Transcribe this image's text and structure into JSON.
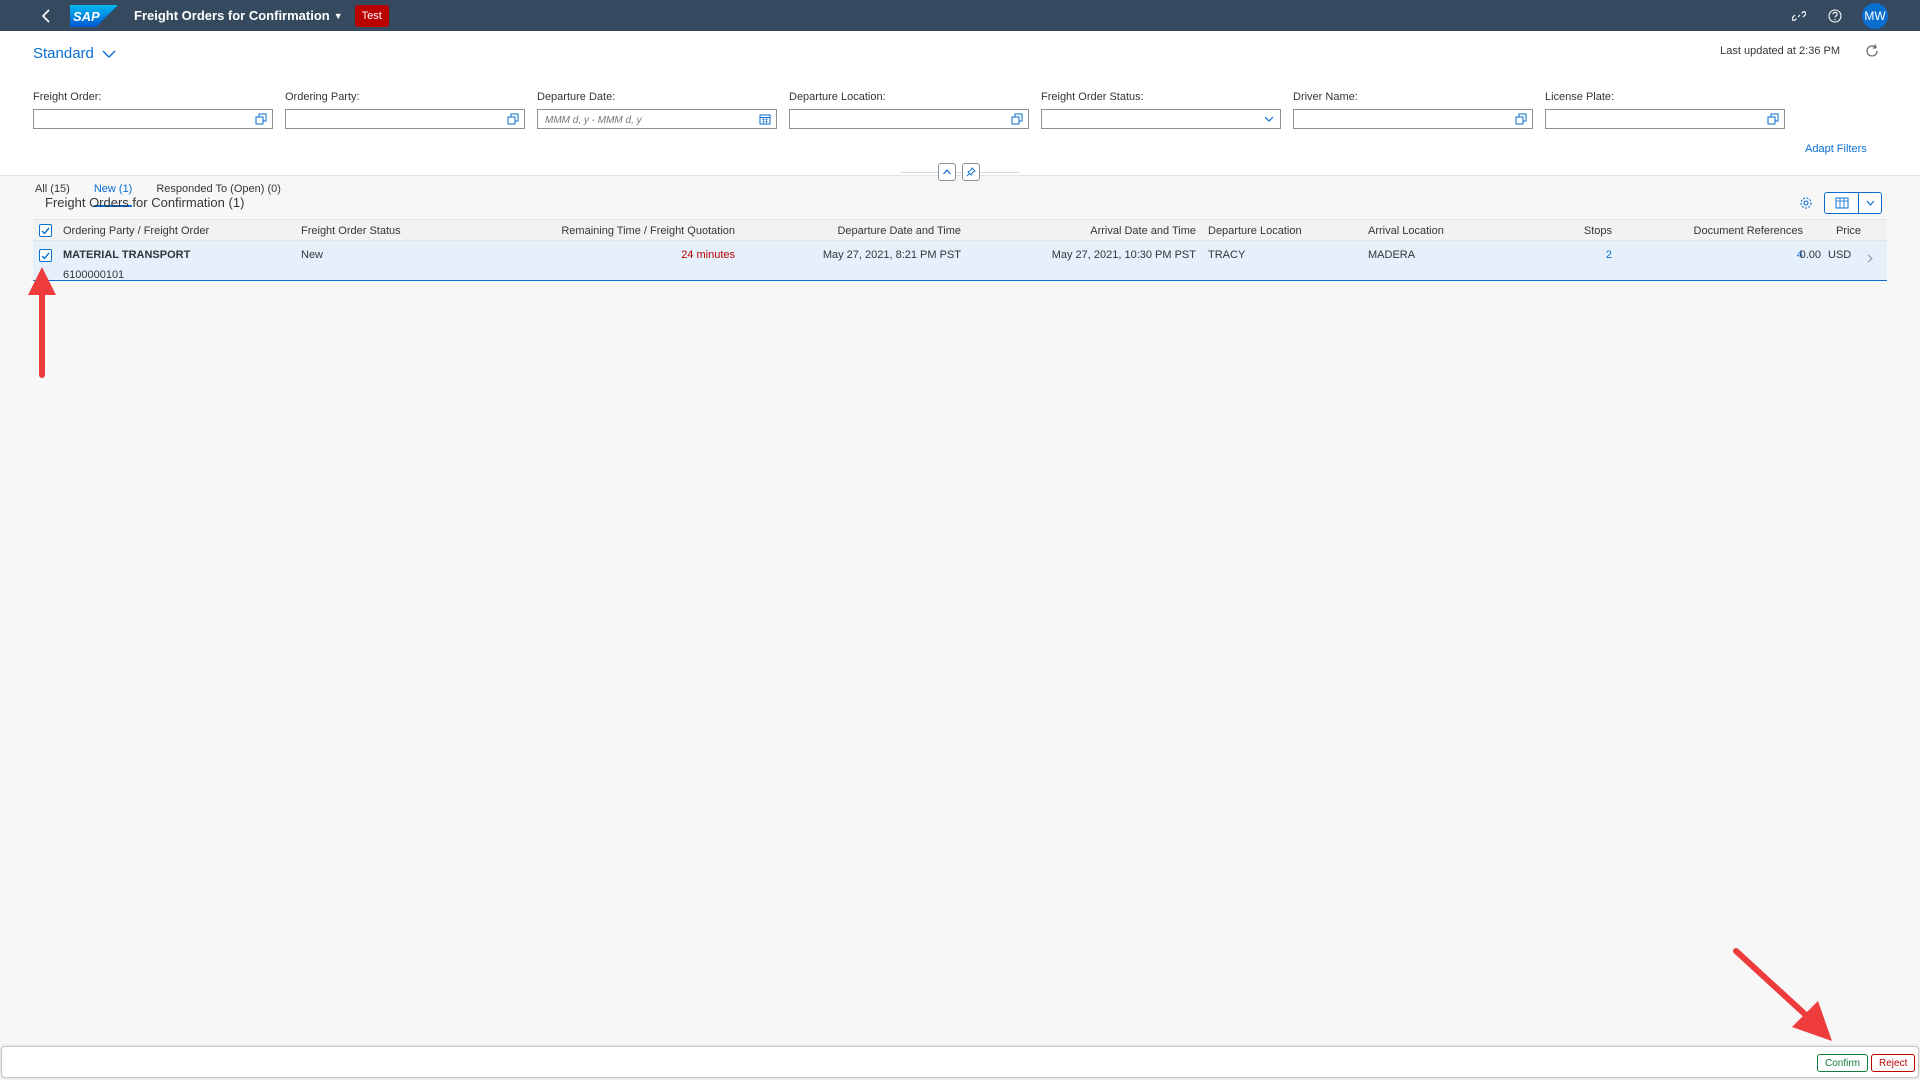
{
  "shell": {
    "logo": "SAP",
    "app_title": "Freight Orders for Confirmation",
    "badge": "Test",
    "avatar_initials": "MW",
    "icons": [
      "back-icon",
      "link-icon",
      "help-icon"
    ]
  },
  "header": {
    "variant": "Standard",
    "last_updated": "Last updated at 2:36 PM",
    "adapt_filters": "Adapt Filters"
  },
  "filters": [
    {
      "label": "Freight Order:",
      "placeholder": ""
    },
    {
      "label": "Ordering Party:",
      "placeholder": ""
    },
    {
      "label": "Departure Date:",
      "placeholder": "MMM d, y - MMM d, y"
    },
    {
      "label": "Departure Location:",
      "placeholder": ""
    },
    {
      "label": "Freight Order Status:",
      "placeholder": ""
    },
    {
      "label": "Driver Name:",
      "placeholder": ""
    },
    {
      "label": "License Plate:",
      "placeholder": ""
    }
  ],
  "tabs": [
    {
      "label": "All (15)"
    },
    {
      "label": "New (1)",
      "active": true
    },
    {
      "label": "Responded To (Open) (0)"
    }
  ],
  "table": {
    "title": "Freight Orders for Confirmation (1)",
    "columns": [
      "Ordering Party / Freight Order",
      "Freight Order Status",
      "Remaining Time / Freight Quotation",
      "Departure Date and Time",
      "Arrival Date and Time",
      "Departure Location",
      "Arrival Location",
      "Stops",
      "Document References",
      "Price"
    ],
    "rows": [
      {
        "ordering_party": "MATERIAL TRANSPORT",
        "freight_order": "6100000101",
        "status": "New",
        "remaining_time": "24 minutes",
        "departure": "May 27, 2021, 8:21 PM PST",
        "arrival": "May 27, 2021, 10:30 PM PST",
        "departure_location": "TRACY",
        "arrival_location": "MADERA",
        "stops": "2",
        "document_references": "4",
        "price": "0.00",
        "currency": "USD",
        "selected": true
      }
    ]
  },
  "footer": {
    "confirm": "Confirm",
    "reject": "Reject"
  },
  "colors": {
    "shell": "#354a5f",
    "accent": "#0a6ed1",
    "negative": "#bb0000",
    "positive": "#107e3e",
    "annotation": "#ee3b3b"
  }
}
